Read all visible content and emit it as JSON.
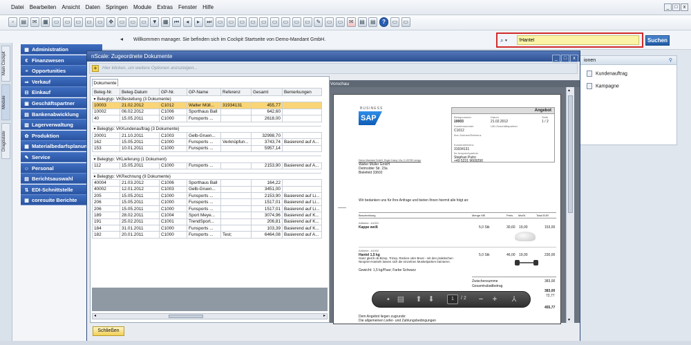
{
  "menu": [
    "Datei",
    "Bearbeiten",
    "Ansicht",
    "Daten",
    "Springen",
    "Module",
    "Extras",
    "Fenster",
    "Hilfe"
  ],
  "window_controls": [
    "_",
    "□",
    "x"
  ],
  "toolbar_icons": [
    "new-icon",
    "print-icon",
    "dispatch-icon",
    "print-preview-icon",
    "doc-icon",
    "doc-icon",
    "doc-icon",
    "doc-icon",
    "doc-icon",
    "move-icon",
    "doc-icon",
    "doc-icon",
    "doc-icon",
    "filter-icon",
    "table-icon",
    "first-icon",
    "prev-icon",
    "next-icon",
    "last-icon",
    "record-icon",
    "doc-icon",
    "doc-icon",
    "doc-icon",
    "doc-icon",
    "doc-icon",
    "doc-icon",
    "doc-icon",
    "doc-icon",
    "edit-icon",
    "doc-icon",
    "doc-icon",
    "mail-icon",
    "report-icon",
    "report-icon",
    "help-icon",
    "doc-icon",
    "doc-icon"
  ],
  "collapse_arrow": "◂",
  "welcome": "Willkommen manager.  Sie befinden sich im Cockpit Startseite von Demo-Mandant GmbH.",
  "search": {
    "dropdown": "⌕ ▾",
    "value": "!Hantel",
    "button": "Suchen"
  },
  "left_tabs": [
    "Main Cockpit",
    "Module",
    "Dragdatate"
  ],
  "nav": [
    {
      "icon": "▦",
      "label": "Administration"
    },
    {
      "icon": "€",
      "label": "Finanzwesen"
    },
    {
      "icon": "≡",
      "label": "Opportunities"
    },
    {
      "icon": "⇒",
      "label": "Verkauf"
    },
    {
      "icon": "⊟",
      "label": "Einkauf"
    },
    {
      "icon": "▣",
      "label": "Geschäftspartner"
    },
    {
      "icon": "▤",
      "label": "Bankenabwicklung"
    },
    {
      "icon": "▥",
      "label": "Lagerverwaltung"
    },
    {
      "icon": "✿",
      "label": "Produktion"
    },
    {
      "icon": "▦",
      "label": "Materialbedarfsplanung"
    },
    {
      "icon": "✎",
      "label": "Service"
    },
    {
      "icon": "☺",
      "label": "Personal"
    },
    {
      "icon": "▤",
      "label": "Berichtsauswahl"
    },
    {
      "icon": "⇅",
      "label": "EDI-Schnittstelle"
    },
    {
      "icon": "▦",
      "label": "coresuite Berichte"
    }
  ],
  "right_panel": {
    "title": "ionen",
    "pin": "⚲",
    "items": [
      "Kundenauftrag",
      "Kampagne"
    ]
  },
  "dialog": {
    "title": "nScale: Zugeordnete Dokumente",
    "controls": [
      "_",
      "□",
      "x"
    ],
    "hint": "Hier klicken, um weitere Optionen anzuzeigen...",
    "tab": "Dokumente",
    "preview_label": "Vorschau",
    "close_button": "Schließen",
    "columns": [
      "Beleg-Nr.",
      "Beleg-Datum",
      "GP-Nr.",
      "GP-Name",
      "Referenz",
      "Gesamt",
      "Bemerkungen"
    ],
    "groups": [
      {
        "title": "Belegtyp: VKBestellung (3 Dokumente)",
        "rows": [
          [
            "10003",
            "21.02.2012",
            "C1012",
            "Walter Müll...",
            "31934131",
            "455,77",
            ""
          ],
          [
            "10002",
            "06.02.2012",
            "C1006",
            "Sporthaus Ball",
            "",
            "642,60",
            ""
          ],
          [
            "40",
            "15.05.2011",
            "C1000",
            "Funsports ...",
            "",
            "2618,00",
            ""
          ]
        ]
      },
      {
        "title": "Belegtyp: VKKundenauftrag (3 Dokumente)",
        "rows": [
          [
            "20001",
            "21.10.2011",
            "C1003",
            "Gelb-Gruen...",
            "",
            "32998,70",
            ""
          ],
          [
            "162",
            "15.05.2011",
            "C1000",
            "Funsports ...",
            "Verknüpfun...",
            "3743,74",
            "Basierend auf A..."
          ],
          [
            "153",
            "10.01.2011",
            "C1000",
            "Funsports ...",
            "",
            "5957,14",
            ""
          ]
        ]
      },
      {
        "title": "Belegtyp: VKLieferung (1 Dokument)",
        "rows": [
          [
            "112",
            "15.05.2011",
            "C1000",
            "Funsports ...",
            "",
            "2153,90",
            "Basierend auf A..."
          ]
        ]
      },
      {
        "title": "Belegtyp: VKRechnung (9 Dokumente)",
        "rows": [
          [
            "40004",
            "21.03.2012",
            "C1006",
            "Sporthaus Ball",
            "",
            "164,22",
            ""
          ],
          [
            "40002",
            "12.01.2012",
            "C1003",
            "Gelb-Gruen...",
            "",
            "3451,00",
            ""
          ],
          [
            "205",
            "15.05.2011",
            "C1000",
            "Funsports ...",
            "",
            "2153,90",
            "Basierend auf Li..."
          ],
          [
            "206",
            "15.05.2011",
            "C1000",
            "Funsports ...",
            "",
            "1517,01",
            "Basierend auf Li..."
          ],
          [
            "206",
            "15.05.2011",
            "C1000",
            "Funsports ...",
            "",
            "1517,01",
            "Basierend auf Li..."
          ],
          [
            "189",
            "28.02.2011",
            "C1004",
            "Sport Meye...",
            "",
            "3074,96",
            "Basierend auf K..."
          ],
          [
            "191",
            "25.02.2011",
            "C1001",
            "TrendSport...",
            "",
            "206,81",
            "Basierend auf K..."
          ],
          [
            "184",
            "31.01.2011",
            "C1000",
            "Funsports ...",
            "",
            "103,39",
            "Basierend auf K..."
          ],
          [
            "182",
            "20.01.2011",
            "C1000",
            "Funsports ...",
            "Test;",
            "6464,08",
            "Basierend auf A..."
          ]
        ]
      }
    ]
  },
  "pdf": {
    "brand_top": "BUSINESS",
    "logo": "SAP",
    "box_title": "Angebot",
    "labels": [
      "Belegnummer",
      "Datum",
      "Seite",
      "Kundennummer",
      "UID-Geschäftspartner",
      "Ihre Zeichen/Referenz",
      "Kundenreferenz",
      "Ihr Ansprechpartner"
    ],
    "values": [
      "10003",
      "21.02.2012",
      "1 / 2",
      "C1012",
      "31934131",
      "Stephan Putro",
      "+49 5231 9669290"
    ],
    "sender": "Demo Mandant GmbH, Enger Kamp 12a, D-33789 Lemgo",
    "address": [
      "Walter Müller GmbH",
      "Detmolder Str. 23a",
      "Bielefeld 33602"
    ],
    "intro": "Wir bedanken uns für Ihre Anfrage und bieten Ihnen hiermit alle folgt an:",
    "table_head": [
      "Beschreibung",
      "Menge ME",
      "Preis",
      "MwSt",
      "Total EUR"
    ],
    "item1": {
      "art": "Artikelnr.: A1001",
      "name": "Kappe weiß",
      "qty": "5,0 Stk",
      "price": "30,60",
      "tax": "19,00",
      "total": "153,00"
    },
    "item2": {
      "art": "Artikelnr.: A1002",
      "name": "Hantel 1,5 kg",
      "desc": "Ganz gleich ob Bizep, Trizep, Rücken oder Brust - mit den praktischen Neopren-Hanteln lassen sich die einzelnen Muskelpartien trainieren.",
      "extra": "Gewicht: 1,5 kg/Paar; Farbe Schwarz",
      "qty": "5,0 Stk",
      "price": "46,00",
      "tax": "19,00",
      "total": "230,00"
    },
    "totals": [
      [
        "Zwischensumme",
        "383,00"
      ],
      [
        "Gesamtrabattbetrag",
        ""
      ],
      [
        "",
        "383,00"
      ],
      [
        "",
        "72,77"
      ],
      [
        "",
        "455,77"
      ]
    ],
    "footer": [
      "Dem Angebot liegen zugrunde:",
      "Die allgemeinen Liefer- und Zahlungsbedingungen"
    ],
    "toolbar": {
      "page": "1",
      "pages": "/ 2"
    }
  }
}
